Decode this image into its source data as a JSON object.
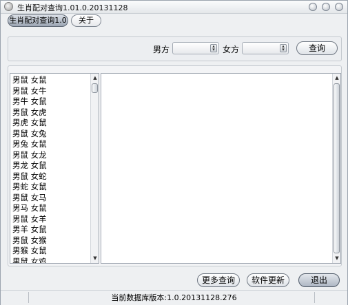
{
  "window": {
    "title": "生肖配对查询1.01.0.20131128"
  },
  "tabs": [
    {
      "label": "生肖配对查询1.0"
    },
    {
      "label": "关于"
    }
  ],
  "query": {
    "male_label": "男方",
    "male_value": "",
    "female_label": "女方",
    "female_value": "",
    "search_button": "查询"
  },
  "results": [
    {
      "label": "男鼠 女鼠"
    },
    {
      "label": "男鼠 女牛"
    },
    {
      "label": "男牛 女鼠"
    },
    {
      "label": "男鼠 女虎"
    },
    {
      "label": "男虎 女鼠"
    },
    {
      "label": "男鼠 女兔"
    },
    {
      "label": "男兔 女鼠"
    },
    {
      "label": "男鼠 女龙"
    },
    {
      "label": "男龙 女鼠"
    },
    {
      "label": "男鼠 女蛇"
    },
    {
      "label": "男蛇 女鼠"
    },
    {
      "label": "男鼠 女马"
    },
    {
      "label": "男马 女鼠"
    },
    {
      "label": "男鼠 女羊"
    },
    {
      "label": "男羊 女鼠"
    },
    {
      "label": "男鼠 女猴"
    },
    {
      "label": "男猴 女鼠"
    },
    {
      "label": "男鼠 女鸡"
    }
  ],
  "detail_text": "",
  "buttons": {
    "more": "更多查询",
    "update": "软件更新",
    "exit": "退出"
  },
  "status": {
    "db_version": "当前数据库版本:1.0.20131128.276"
  }
}
